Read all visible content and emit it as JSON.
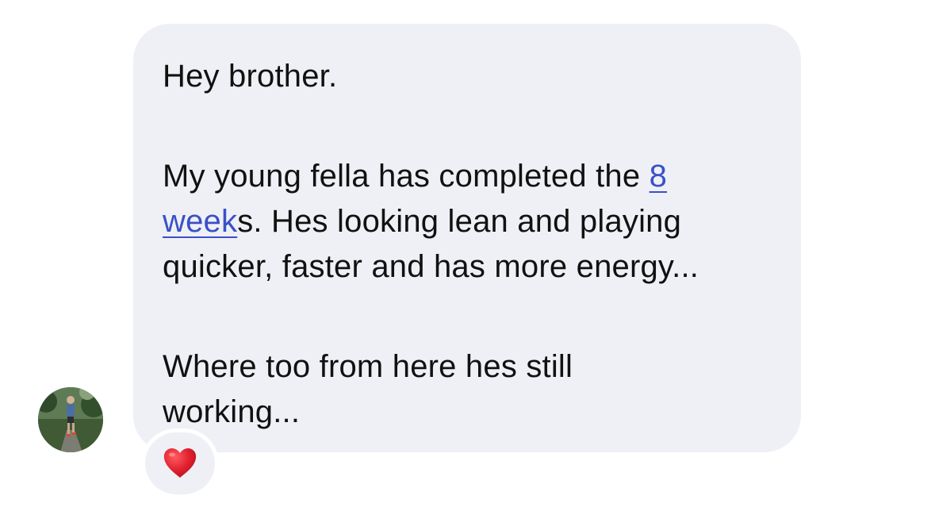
{
  "message": {
    "greeting": "Hey brother.",
    "paragraph2": {
      "line1_text": "My young fella has completed the ",
      "line1_link": "8 ",
      "line2_link": "week",
      "line2_text": "s. Hes looking lean and playing",
      "line3": "quicker, faster and has more energy..."
    },
    "paragraph3": {
      "line1": "Where too from here hes still",
      "line2": "working..."
    }
  },
  "reaction": {
    "emoji_name": "red-heart-icon",
    "color": "#e0202f"
  },
  "colors": {
    "bubble_background": "#eff0f5",
    "link": "#3a50c9",
    "text": "#111111"
  }
}
